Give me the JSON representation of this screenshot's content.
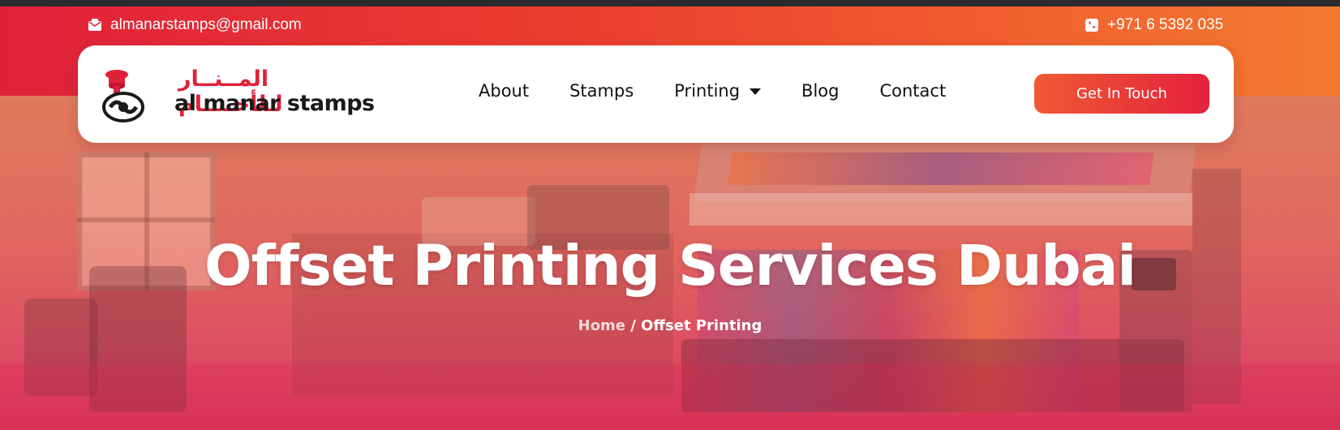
{
  "topbar": {
    "email": "almanarstamps@gmail.com",
    "email_icon": "envelope-icon",
    "phone": "+971 6 5392 035",
    "phone_icon": "phone-icon"
  },
  "brand": {
    "name_ar": "المــنــار لـلأخـتــام",
    "name_en": "al manar stamps",
    "logo_icon": "stamp-logo-icon"
  },
  "nav": {
    "items": [
      {
        "label": "About"
      },
      {
        "label": "Stamps"
      },
      {
        "label": "Printing",
        "dropdown": true
      },
      {
        "label": "Blog"
      },
      {
        "label": "Contact"
      }
    ],
    "cta_label": "Get In Touch"
  },
  "hero": {
    "title": "Offset Printing Services Dubai",
    "breadcrumb": {
      "home": "Home",
      "separator": "/",
      "current": "Offset Printing"
    }
  },
  "colors": {
    "brand_red": "#e0213a",
    "brand_orange": "#f47a2f"
  }
}
